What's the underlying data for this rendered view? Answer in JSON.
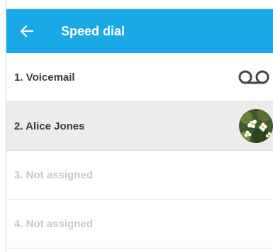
{
  "header": {
    "title": "Speed dial",
    "back_icon": "arrow-left-icon"
  },
  "colors": {
    "appbar": "#1aa9e8",
    "selected_row": "#ececec"
  },
  "speed_dial": [
    {
      "label": "1. Voicemail",
      "icon": "voicemail-icon",
      "assigned": true
    },
    {
      "label": "2. Alice Jones",
      "icon": "contact-avatar",
      "assigned": true,
      "selected": true
    },
    {
      "label": "3. Not assigned",
      "assigned": false
    },
    {
      "label": "4. Not assigned",
      "assigned": false
    }
  ]
}
